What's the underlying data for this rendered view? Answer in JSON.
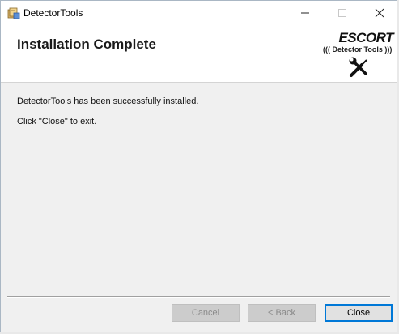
{
  "window": {
    "title": "DetectorTools"
  },
  "titlebar": {
    "min_label": "–",
    "max_label": "☐",
    "close_label": "✕"
  },
  "banner": {
    "title": "Installation Complete",
    "logo_brand": "ESCORT",
    "logo_sub": "((( Detector Tools )))"
  },
  "content": {
    "line1": "DetectorTools has been successfully installed.",
    "line2": "Click \"Close\" to exit."
  },
  "buttons": {
    "cancel": "Cancel",
    "back": "< Back",
    "close": "Close"
  },
  "icons": {
    "app": "installer-icon",
    "tools": "tools-icon"
  }
}
